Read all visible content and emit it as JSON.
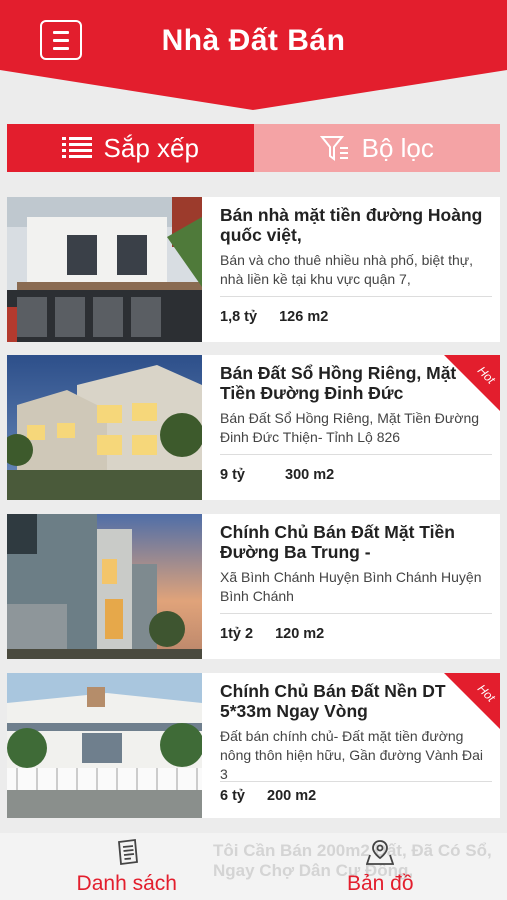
{
  "header": {
    "title": "Nhà Đất Bán",
    "brand_color": "#e31e2d"
  },
  "tabs": {
    "sort_label": "Sắp xếp",
    "filter_label": "Bộ lọc"
  },
  "listings": [
    {
      "title": "Bán nhà mặt tiền đường Hoàng quốc việt,",
      "description": "Bán và cho thuê nhiều nhà phố, biệt thự, nhà liền kề tại khu vực quận 7,",
      "price": "1,8 tỷ",
      "area": "126 m2",
      "hot": false
    },
    {
      "title": "Bán Đất Sổ Hồng Riêng, Mặt Tiền Đường Đinh Đức",
      "description": "Bán Đất Sổ Hồng Riêng, Mặt Tiền Đường Đinh Đức Thiện- Tỉnh Lộ 826",
      "price": "9 tỷ",
      "area": "300 m2",
      "hot": true,
      "hot_label": "Hot"
    },
    {
      "title": "Chính Chủ Bán Đất Mặt Tiền Đường Ba Trung -",
      "description": "Xã Bình Chánh Huyện Bình Chánh Huyện Bình Chánh",
      "price": "1tỷ 2",
      "area": "120 m2",
      "hot": false
    },
    {
      "title": "Chính Chủ Bán Đất Nền DT 5*33m Ngay Vòng",
      "description": "Đất bán chính chủ- Đất mặt tiền đường nông thôn hiện hữu, Gần đường Vành Đai 3",
      "price": "6 tỷ",
      "area": "200 m2",
      "hot": true,
      "hot_label": "Hot"
    }
  ],
  "partial_listing": {
    "title": "Tôi Cần Bán 200m2 Đất, Đã Có Sổ, Ngay Chợ Dân Cư Đông,"
  },
  "bottom_nav": {
    "list_label": "Danh sách",
    "map_label": "Bản đồ"
  }
}
